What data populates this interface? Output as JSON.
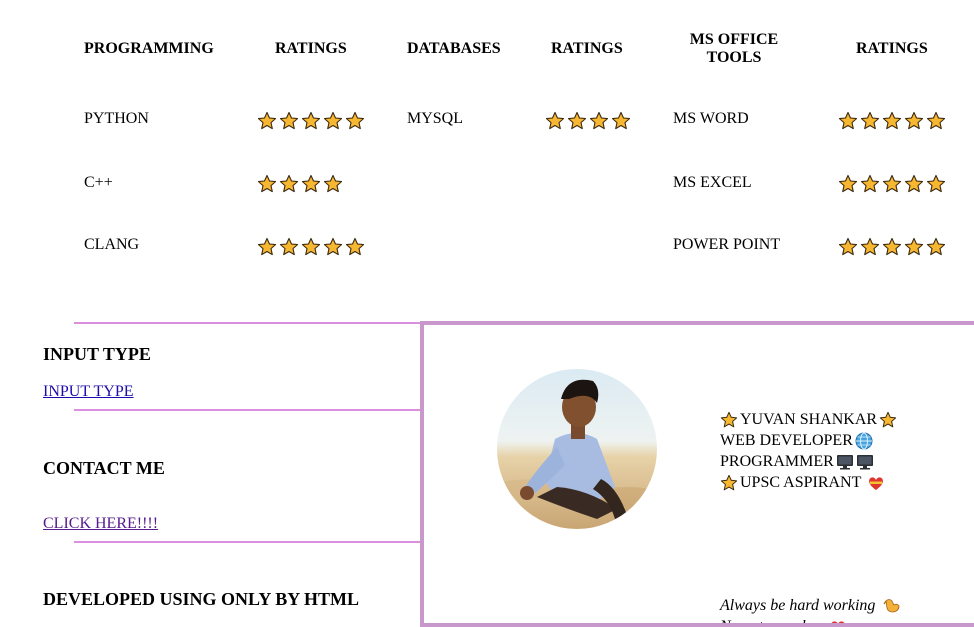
{
  "skills": {
    "headers": [
      "PROGRAMMING",
      "RATINGS",
      "DATABASES",
      "RATINGS",
      "MS OFFICE TOOLS",
      "RATINGS"
    ],
    "programming": [
      {
        "name": "PYTHON",
        "rating": 5
      },
      {
        "name": "C++",
        "rating": 4
      },
      {
        "name": "CLANG",
        "rating": 5
      }
    ],
    "databases": [
      {
        "name": "MYSQL",
        "rating": 4
      }
    ],
    "office": [
      {
        "name": "MS WORD",
        "rating": 5
      },
      {
        "name": "MS EXCEL",
        "rating": 5
      },
      {
        "name": "POWER POINT",
        "rating": 5
      }
    ]
  },
  "sections": {
    "input_type": {
      "heading": "INPUT TYPE",
      "link": "INPUT TYPE"
    },
    "contact": {
      "heading": "CONTACT ME",
      "link": "CLICK HERE!!!!"
    },
    "developed": {
      "heading": "DEVELOPED USING ONLY BY HTML"
    }
  },
  "profile": {
    "name": "YUVAN SHANKAR",
    "role1": "WEB DEVELOPER",
    "role2": "PROGRAMMER",
    "role3": "UPSC ASPIRANT",
    "quote1": "Always be hard working",
    "quote2": "No guts no glory"
  },
  "colors": {
    "star_fill": "#f7b731",
    "divider": "#dc8fdc",
    "frame": "#c898cc",
    "link": "#1a0dab",
    "link_visited": "#551a8b"
  },
  "icons": [
    "star-icon",
    "globe-icon",
    "computer-icon",
    "heart-icon",
    "muscle-icon"
  ]
}
